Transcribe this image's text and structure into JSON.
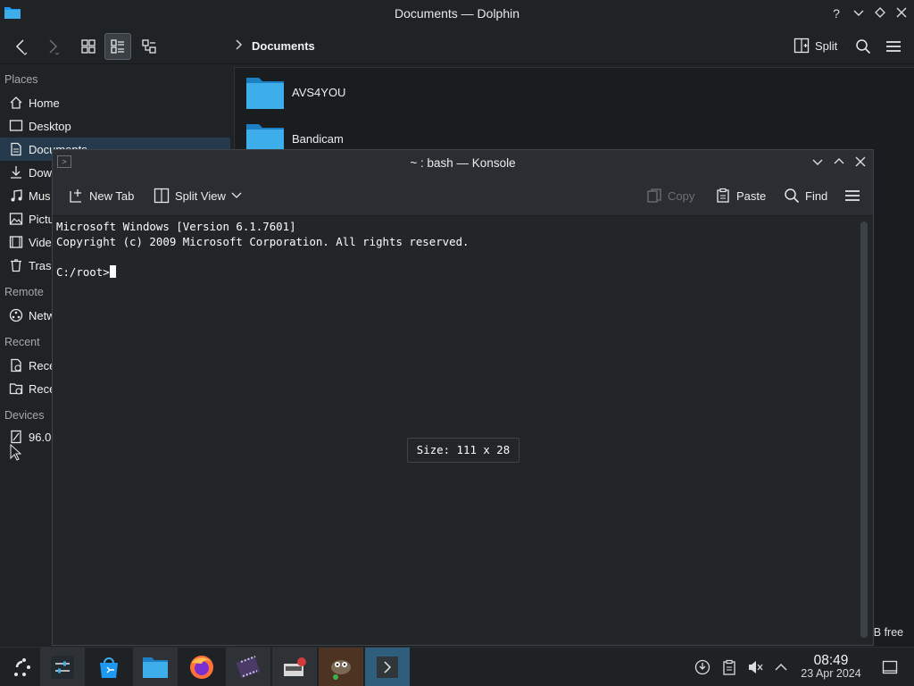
{
  "dolphin": {
    "title": "Documents — Dolphin",
    "breadcrumb": "Documents",
    "split_label": "Split",
    "places": {
      "places_header": "Places",
      "items": [
        {
          "label": "Home",
          "icon": "home-icon"
        },
        {
          "label": "Desktop",
          "icon": "desktop-icon"
        },
        {
          "label": "Documents",
          "icon": "documents-icon",
          "selected": true
        },
        {
          "label": "Dow",
          "icon": "downloads-icon"
        },
        {
          "label": "Mus",
          "icon": "music-icon"
        },
        {
          "label": "Pictu",
          "icon": "pictures-icon"
        },
        {
          "label": "Vide",
          "icon": "videos-icon"
        },
        {
          "label": "Tras",
          "icon": "trash-icon"
        }
      ],
      "remote_header": "Remote",
      "remote_items": [
        {
          "label": "Netw",
          "icon": "network-icon"
        }
      ],
      "recent_header": "Recent",
      "recent_items": [
        {
          "label": "Rece",
          "icon": "recent-files-icon"
        },
        {
          "label": "Rece",
          "icon": "recent-locations-icon"
        }
      ],
      "devices_header": "Devices",
      "device_items": [
        {
          "label": "96.0",
          "icon": "drive-icon"
        }
      ]
    },
    "files": [
      {
        "name": "AVS4YOU",
        "icon": "folder-icon"
      },
      {
        "name": "Bandicam",
        "icon": "folder-icon"
      }
    ],
    "free_space": "iB free"
  },
  "konsole": {
    "title": "~ : bash — Konsole",
    "toolbar": {
      "new_tab": "New Tab",
      "split_view": "Split View",
      "copy": "Copy",
      "paste": "Paste",
      "find": "Find"
    },
    "terminal": {
      "line1": "Microsoft Windows [Version 6.1.7601]",
      "line2": "Copyright (c) 2009 Microsoft Corporation. All rights reserved.",
      "prompt": "C:/root>"
    },
    "size_tooltip": "Size: 111 x 28"
  },
  "taskbar": {
    "time": "08:49",
    "date": "23 Apr 2024"
  },
  "colors": {
    "accent": "#3daee9",
    "selection": "#253a4c",
    "active_task": "#2f5d7c"
  }
}
